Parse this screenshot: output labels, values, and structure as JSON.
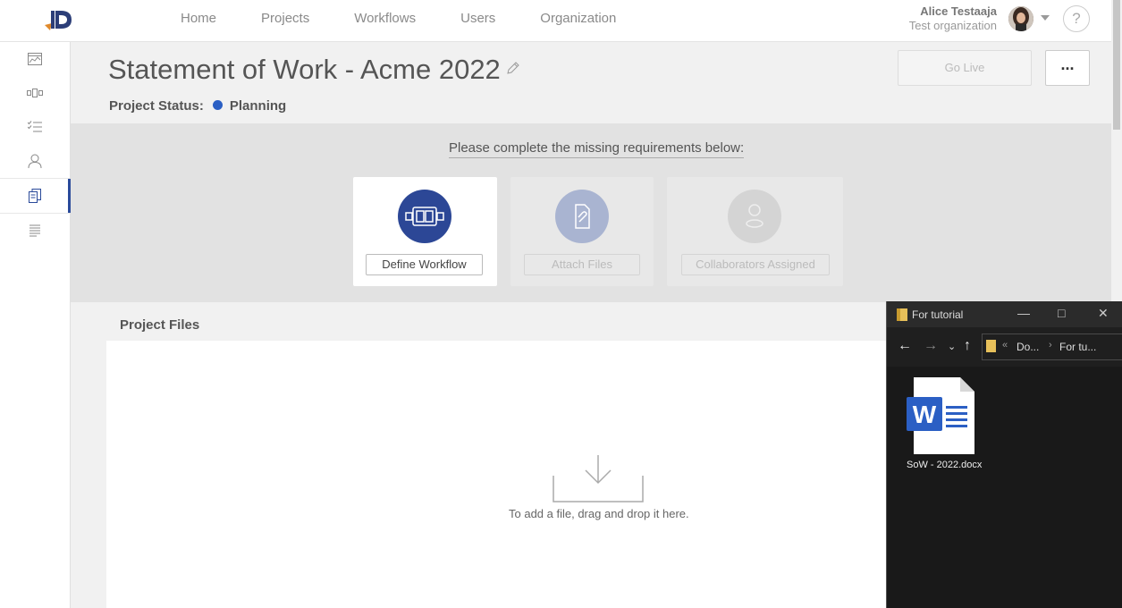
{
  "nav": {
    "items": [
      "Home",
      "Projects",
      "Workflows",
      "Users",
      "Organization"
    ]
  },
  "user": {
    "name": "Alice Testaaja",
    "org": "Test organization"
  },
  "help_label": "?",
  "page": {
    "title": "Statement of Work - Acme 2022",
    "status_label": "Project Status:",
    "status_value": "Planning",
    "go_live_label": "Go Live",
    "more_label": "..."
  },
  "requirements": {
    "heading": "Please complete the missing requirements below:",
    "cards": [
      {
        "label": "Define Workflow",
        "icon": "workflow-icon",
        "enabled": true
      },
      {
        "label": "Attach Files",
        "icon": "attach-file-icon",
        "enabled": false
      },
      {
        "label": "Collaborators Assigned",
        "icon": "collaborator-icon",
        "enabled": false
      }
    ]
  },
  "files": {
    "heading": "Project Files",
    "drop_hint": "To add a file, drag and drop it here."
  },
  "explorer": {
    "title": "For tutorial",
    "crumb1": "Do...",
    "crumb2": "For tu...",
    "file_name": "SoW - 2022.docx"
  },
  "colors": {
    "accent": "#2c4796",
    "status_dot": "#2b5fc4"
  }
}
